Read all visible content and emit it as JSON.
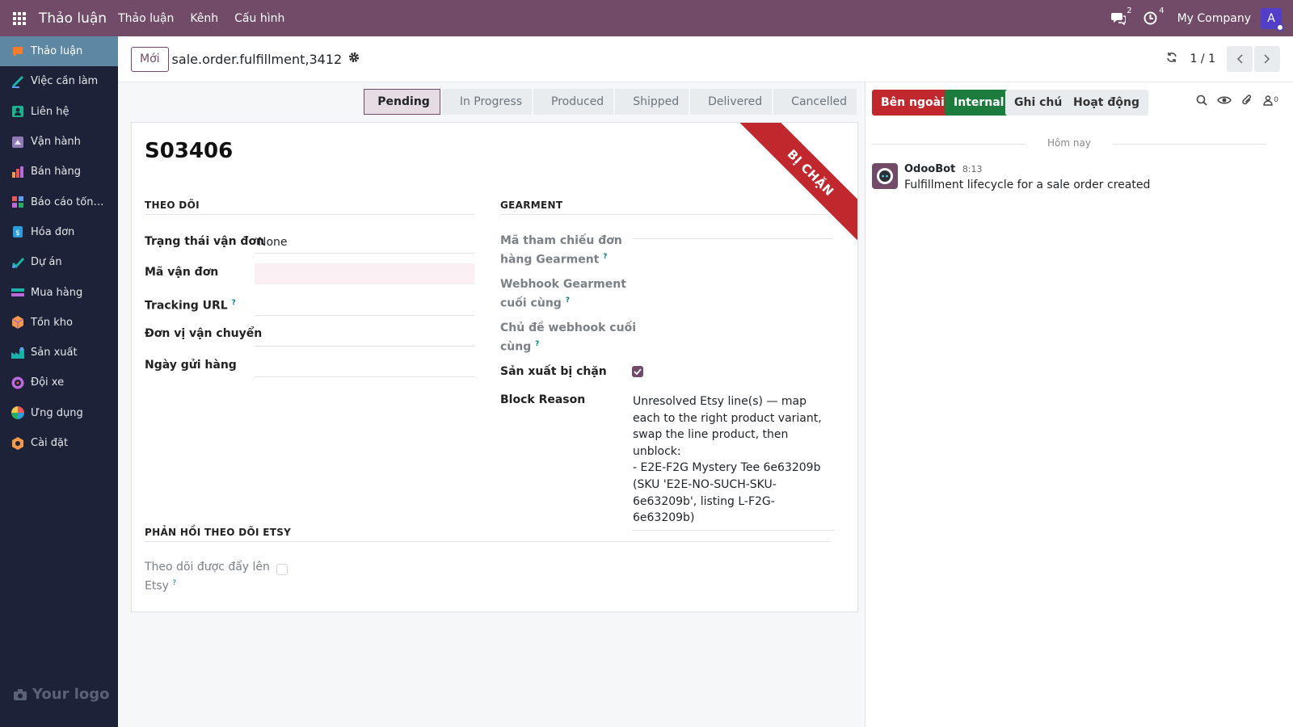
{
  "topbar": {
    "app_title": "Thảo luận",
    "menu": [
      "Thảo luận",
      "Kênh",
      "Cấu hình"
    ],
    "messages_count": "2",
    "activities_count": "4",
    "company": "My Company",
    "avatar_letter": "A",
    "brand_color": "#714b67"
  },
  "sidebar": {
    "items": [
      {
        "label": "Thảo luận",
        "icon": "discuss-icon",
        "active": true
      },
      {
        "label": "Việc cần làm",
        "icon": "todo-icon"
      },
      {
        "label": "Liên hệ",
        "icon": "contacts-icon"
      },
      {
        "label": "Vận hành",
        "icon": "operations-icon"
      },
      {
        "label": "Bán hàng",
        "icon": "sales-icon"
      },
      {
        "label": "Báo cáo tổng ...",
        "icon": "reporting-icon"
      },
      {
        "label": "Hóa đơn",
        "icon": "invoicing-icon"
      },
      {
        "label": "Dự án",
        "icon": "project-icon"
      },
      {
        "label": "Mua hàng",
        "icon": "purchase-icon"
      },
      {
        "label": "Tồn kho",
        "icon": "inventory-icon"
      },
      {
        "label": "Sản xuất",
        "icon": "manufacturing-icon"
      },
      {
        "label": "Đội xe",
        "icon": "fleet-icon"
      },
      {
        "label": "Ứng dụng",
        "icon": "apps-icon"
      },
      {
        "label": "Cài đặt",
        "icon": "settings-icon"
      }
    ],
    "footer_logo": "Your logo"
  },
  "control": {
    "new_label": "Mới",
    "record_title": "sale.order.fulfillment,3412",
    "pager": "1 / 1"
  },
  "statusbar": {
    "stages": [
      "Pending",
      "In Progress",
      "Produced",
      "Shipped",
      "Delivered",
      "Cancelled"
    ],
    "active": "Pending"
  },
  "form": {
    "ribbon": "BỊ CHẶN",
    "reference": "S03406",
    "tracking_section": "THEO DÕI",
    "gearment_section": "GEARMENT",
    "etsy_section": "PHẢN HỒI THEO DÕI ETSY",
    "fields": {
      "shipping_status_label": "Trạng thái vận đơn",
      "shipping_status_value": "None",
      "tracking_number_label": "Mã vận đơn",
      "tracking_url_label": "Tracking URL",
      "carrier_label": "Đơn vị vận chuyển",
      "ship_date_label": "Ngày gửi hàng",
      "gearment_ref_label_1": "Mã tham chiếu đơn",
      "gearment_ref_label_2": "hàng Gearment",
      "webhook_label_1": "Webhook Gearment",
      "webhook_label_2": "cuối cùng",
      "webhook_topic_label_1": "Chủ đề webhook cuối",
      "webhook_topic_label_2": "cùng",
      "blocked_label": "Sản xuất bị chặn",
      "block_reason_label": "Block Reason",
      "block_reason_value": "Unresolved Etsy line(s) — map each to the right product variant, swap the line product, then unblock:\n- E2E-F2G Mystery Tee 6e63209b (SKU 'E2E-NO-SUCH-SKU-6e63209b', listing L-F2G-6e63209b)",
      "etsy_pushed_label_1": "Theo dõi được đẩy lên",
      "etsy_pushed_label_2": "Etsy",
      "help_mark": "?"
    },
    "blocked_checked": true,
    "etsy_pushed_checked": false
  },
  "chatter": {
    "buttons": {
      "external": "Bên ngoài",
      "internal": "Internal",
      "note": "Ghi chú",
      "activity": "Hoạt động"
    },
    "followers_count": "0",
    "day_separator": "Hôm nay",
    "message": {
      "author": "OdooBot",
      "time": "8:13",
      "text": "Fulfillment lifecycle for a sale order created"
    }
  }
}
